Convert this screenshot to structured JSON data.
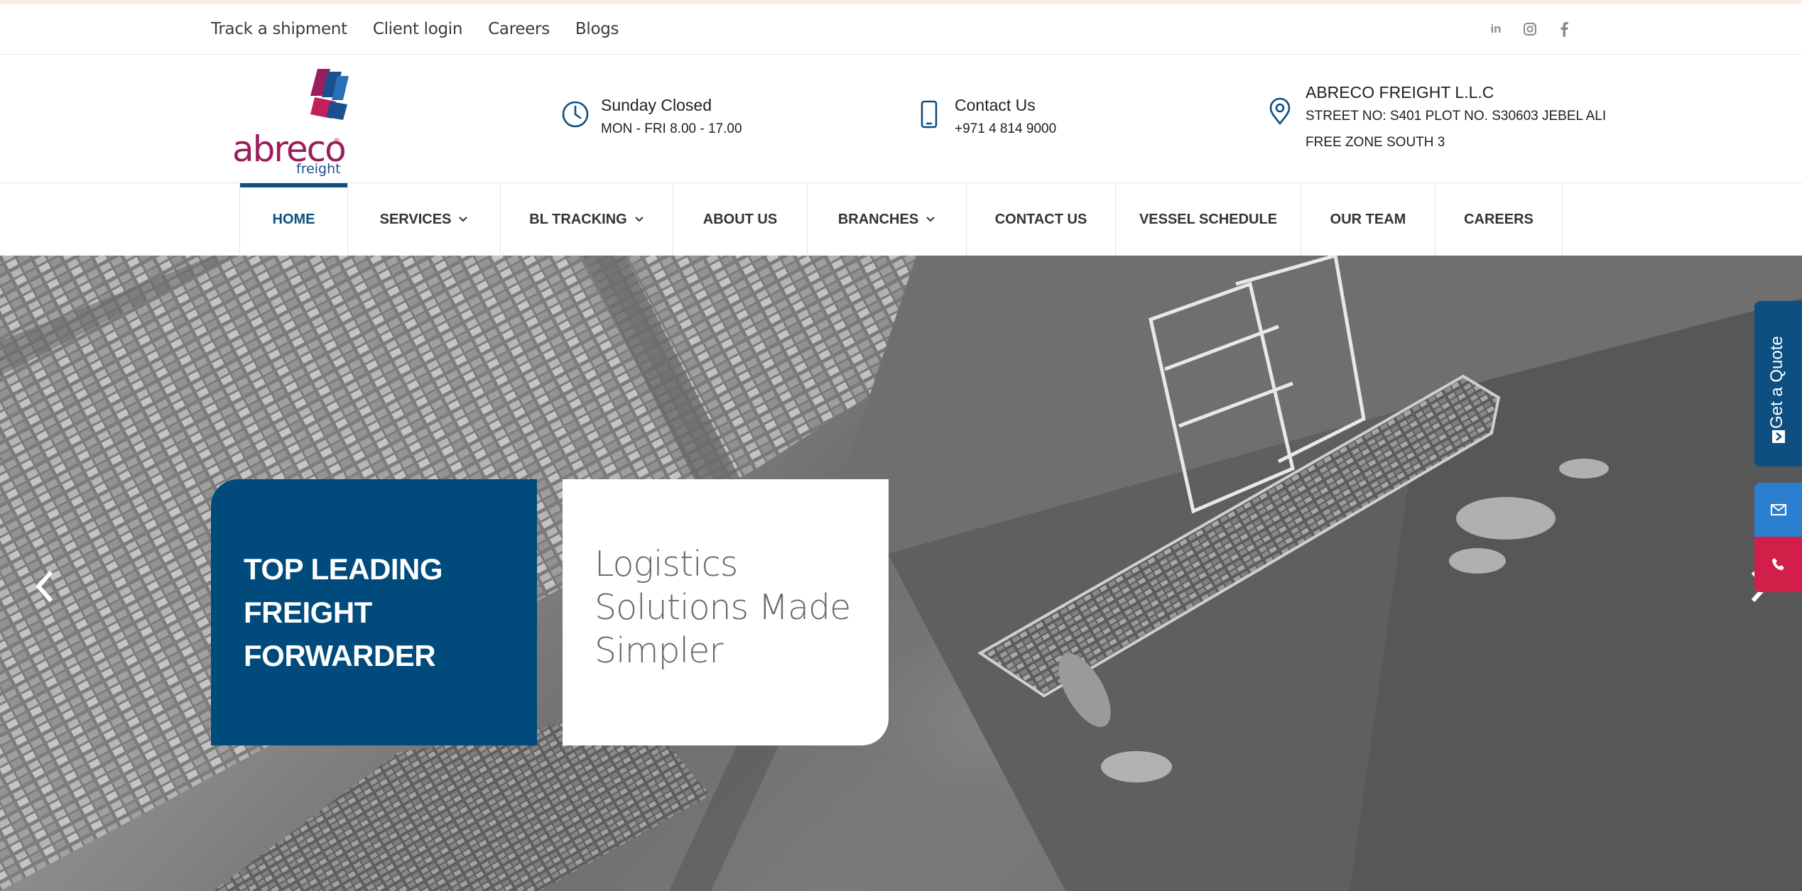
{
  "topbar": {
    "links": [
      "Track a shipment",
      "Client login",
      "Careers",
      "Blogs"
    ],
    "social": [
      "linkedin-icon",
      "instagram-icon",
      "facebook-icon"
    ]
  },
  "brand": {
    "name": "abreco",
    "sub": "freight",
    "reg": "®",
    "colors": {
      "primary": "#9c1d5b",
      "secondary": "#1b4f8f"
    }
  },
  "info": {
    "hours": {
      "title": "Sunday Closed",
      "detail": "MON - FRI 8.00 - 17.00",
      "icon": "clock-icon"
    },
    "contact": {
      "title": "Contact Us",
      "detail": "+971 4 814 9000",
      "icon": "mobile-phone-icon"
    },
    "address": {
      "title": "ABRECO FREIGHT L.L.C",
      "line1": "STREET NO: S401 PLOT NO. S30603 JEBEL ALI",
      "line2": "FREE ZONE SOUTH 3",
      "icon": "map-pin-icon"
    }
  },
  "nav": {
    "items": [
      {
        "label": "HOME",
        "active": true,
        "dropdown": false
      },
      {
        "label": "SERVICES",
        "active": false,
        "dropdown": true
      },
      {
        "label": "BL TRACKING",
        "active": false,
        "dropdown": true
      },
      {
        "label": "ABOUT US",
        "active": false,
        "dropdown": false
      },
      {
        "label": "BRANCHES",
        "active": false,
        "dropdown": true
      },
      {
        "label": "CONTACT US",
        "active": false,
        "dropdown": false
      },
      {
        "label": "VESSEL SCHEDULE",
        "active": false,
        "dropdown": false
      },
      {
        "label": "OUR TEAM",
        "active": false,
        "dropdown": false
      },
      {
        "label": "CAREERS",
        "active": false,
        "dropdown": false
      }
    ],
    "accent": "#0d4f80"
  },
  "hero": {
    "line1": "TOP LEADING",
    "line2": "FREIGHT",
    "line3": "FORWARDER",
    "tag1": "Logistics",
    "tag2": "Solutions Made",
    "tag3": "Simpler"
  },
  "side": {
    "quote_label": "Get a Quote",
    "quote_icon": "arrow-right-square-icon",
    "mail_icon": "envelope-icon",
    "phone_icon": "phone-icon",
    "colors": {
      "quote": "#0d4f80",
      "mail": "#2a7fcf",
      "phone": "#d21f4a"
    }
  }
}
